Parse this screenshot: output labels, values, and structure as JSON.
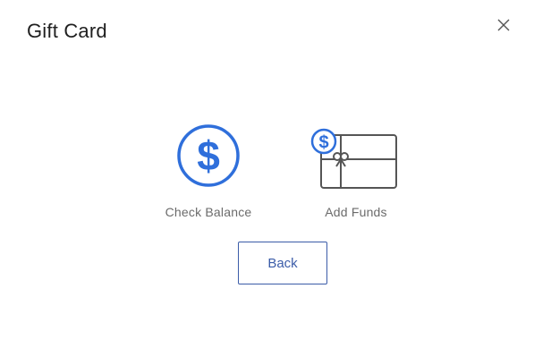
{
  "dialog": {
    "title": "Gift Card"
  },
  "options": {
    "check_balance": {
      "label": "Check Balance",
      "icon": "dollar-circle-icon"
    },
    "add_funds": {
      "label": "Add Funds",
      "icon": "gift-card-dollar-icon"
    }
  },
  "actions": {
    "back_label": "Back"
  },
  "colors": {
    "accent": "#2f6fdb",
    "button_border": "#3b5ca8",
    "label_text": "#6b6b6b",
    "title_text": "#1f1f1f",
    "card_outline": "#555555"
  }
}
